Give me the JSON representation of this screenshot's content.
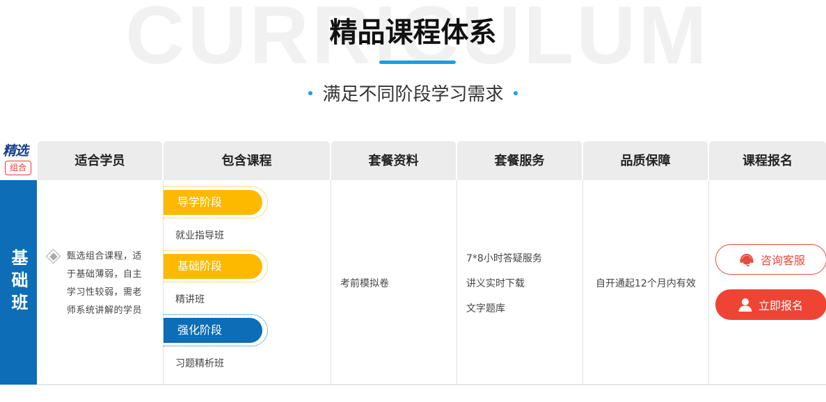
{
  "watermark": "CURRICULUM",
  "title": "精品课程体系",
  "subtitle": "满足不同阶段学习需求",
  "logo": {
    "line1": "精选",
    "line2": "组合"
  },
  "colors": {
    "accent_blue": "#0d6db6",
    "title_bar": "#1a9fe0",
    "stage_yellow": "#fdb900",
    "cta_red": "#ef4434"
  },
  "table": {
    "headers": [
      "适合学员",
      "包含课程",
      "套餐资料",
      "套餐服务",
      "品质保障",
      "课程报名"
    ],
    "row": {
      "label": "基础班",
      "suitable": "甄选组合课程，适于基础薄弱，自主学习性较弱，需老师系统讲解的学员",
      "stages": [
        {
          "stage": "导学阶段",
          "course": "就业指导班"
        },
        {
          "stage": "基础阶段",
          "course": "精讲班"
        },
        {
          "stage": "强化阶段",
          "course": "习题精析班"
        }
      ],
      "materials": "考前模拟卷",
      "services": [
        "7*8小时答疑服务",
        "讲义实时下载",
        "文字题库"
      ],
      "guarantee": "自开通起12个月内有效",
      "buttons": {
        "consult": {
          "label": "咨询客服",
          "icon": "headset-icon"
        },
        "enroll": {
          "label": "立即报名",
          "icon": "user-icon"
        }
      }
    }
  }
}
